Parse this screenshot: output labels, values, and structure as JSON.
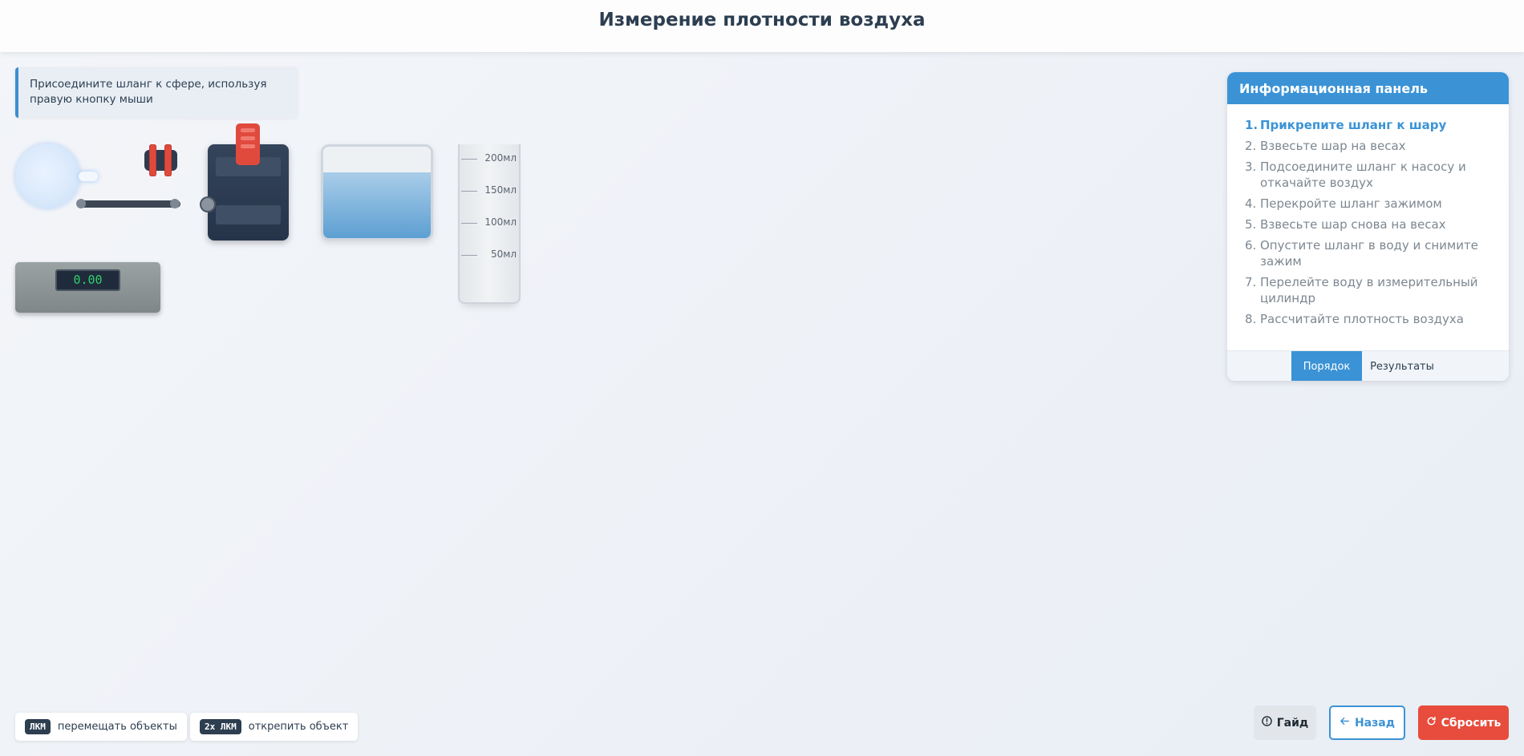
{
  "header": {
    "title": "Измерение плотности воздуха"
  },
  "hint": {
    "text": "Присоедините шланг к сфере, используя правую кнопку мыши"
  },
  "scale": {
    "reading": "0.00"
  },
  "cylinder": {
    "marks": [
      "200мл",
      "150мл",
      "100мл",
      "50мл"
    ]
  },
  "info_panel": {
    "title": "Информационная панель",
    "steps": [
      {
        "num": "1.",
        "text": "Прикрепите шланг к шару"
      },
      {
        "num": "2.",
        "text": "Взвесьте шар на весах"
      },
      {
        "num": "3.",
        "text": "Подсоедините шланг к насосу и откачайте воздух"
      },
      {
        "num": "4.",
        "text": "Перекройте шланг зажимом"
      },
      {
        "num": "5.",
        "text": "Взвесьте шар снова на весах"
      },
      {
        "num": "6.",
        "text": "Опустите шланг в воду и снимите зажим"
      },
      {
        "num": "7.",
        "text": "Перелейте воду в измерительный цилиндр"
      },
      {
        "num": "8.",
        "text": "Рассчитайте плотность воздуха"
      }
    ],
    "tabs": {
      "order": "Порядок",
      "results": "Результаты"
    }
  },
  "controls": {
    "lmb_key": "ЛКМ",
    "lmb_label": "перемещать объекты",
    "dbl_key": "2х ЛКМ",
    "dbl_label": "открепить объект"
  },
  "buttons": {
    "guide": "Гайд",
    "back": "Назад",
    "reset": "Сбросить"
  },
  "icons": {
    "guide": "info-circle-icon",
    "back": "arrow-left-icon",
    "reset": "refresh-icon"
  },
  "colors": {
    "accent": "#3b93d6",
    "danger": "#e74c3c",
    "clamp": "#e04a3c"
  }
}
